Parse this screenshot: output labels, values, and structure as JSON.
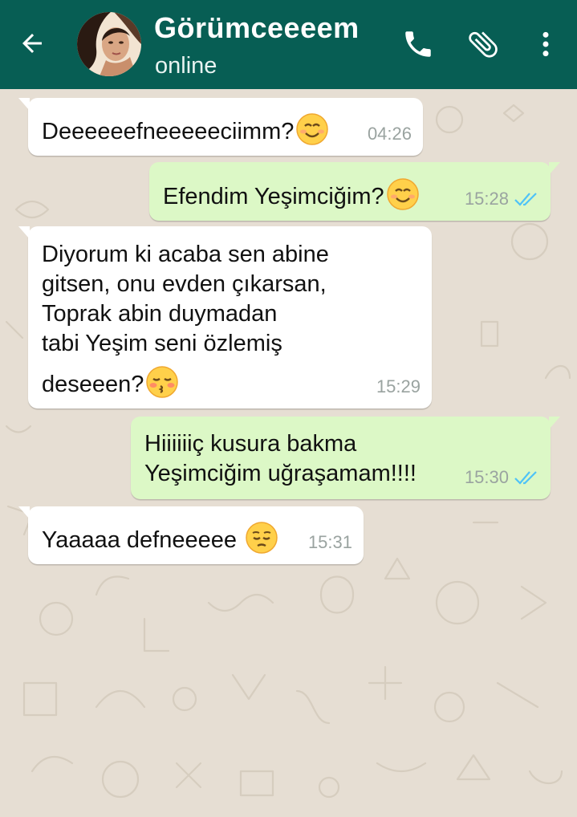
{
  "header": {
    "contact_name": "Görümceeeem",
    "status": "online",
    "icons": [
      "back-arrow-icon",
      "phone-icon",
      "paperclip-icon",
      "more-vert-icon"
    ],
    "colors": {
      "bar": "#075e54",
      "outgoing_bubble": "#dcf8c6",
      "incoming_bubble": "#ffffff",
      "read_ticks": "#4fc3f7"
    }
  },
  "messages": [
    {
      "direction": "incoming",
      "lines": [
        "Deeeeeefneeeeeciimm?"
      ],
      "emoji": "smiling-face-icon",
      "time": "04:26"
    },
    {
      "direction": "outgoing",
      "lines": [
        "Efendim Yeşimciğim?"
      ],
      "emoji": "smiling-face-icon",
      "time": "15:28",
      "status": "read"
    },
    {
      "direction": "incoming",
      "lines": [
        "Diyorum ki acaba sen abine",
        "gitsen, onu evden çıkarsan,",
        "Toprak abin duymadan",
        "tabi Yeşim seni özlemiş",
        "deseeen?"
      ],
      "emoji": "kissing-face-icon",
      "time": "15:29"
    },
    {
      "direction": "outgoing",
      "lines": [
        "Hiiiiiiç kusura bakma",
        "Yeşimciğim uğraşamam!!!!"
      ],
      "time": "15:30",
      "status": "read"
    },
    {
      "direction": "incoming",
      "lines": [
        "Yaaaaa defneeeee"
      ],
      "emoji": "pensive-face-icon",
      "time": "15:31"
    }
  ]
}
